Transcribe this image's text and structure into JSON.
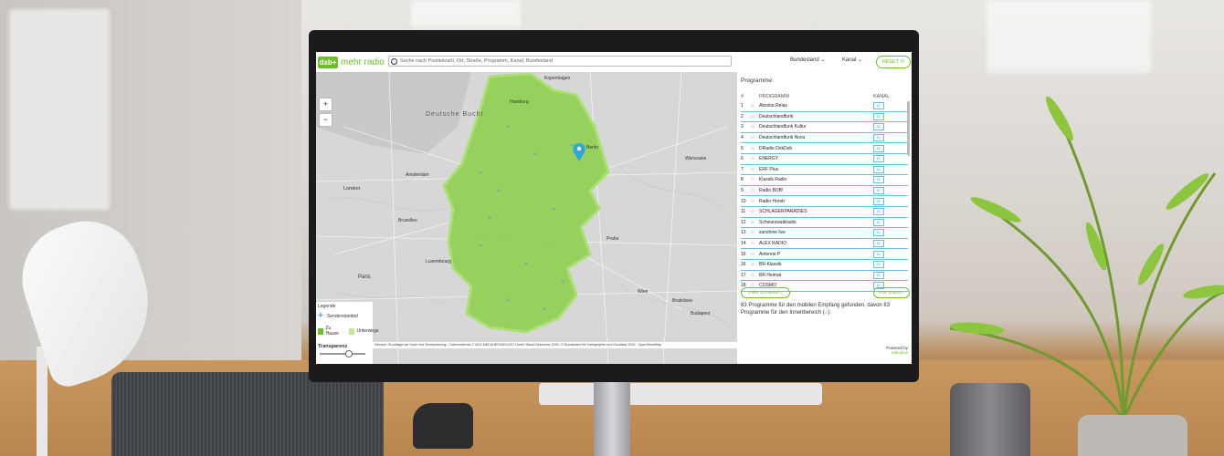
{
  "app": {
    "logo_box": "dab+",
    "logo_text": "mehr radio",
    "search_placeholder": "Suche nach Postleitzahl, Ort, Straße, Programm, Kanal, Bundesland",
    "dropdown_state": "Bundesland",
    "dropdown_channel": "Kanal",
    "reset_label": "RESET"
  },
  "map": {
    "country_label": "Deutsche Bucht",
    "cities": [
      "Hamburg",
      "Berlin",
      "Warszawa",
      "London",
      "Amsterdam",
      "Bruxelles",
      "Paris",
      "Praha",
      "Wien",
      "Budapest",
      "Luxembourg",
      "Bratislava",
      "Kopenhagen"
    ],
    "legend_title": "Legende",
    "legend_item1": "Senderstandort",
    "legend_item2a": "Zu Hause",
    "legend_item2b": "Unterwegs",
    "transparency_label": "Transparenz",
    "attribution": "Hinweis: Grundlage der Karte und Sendeplanung... Datenmaterial: © AKG MEDIA BROADCAST GmbH Stand Dezember 2020 / © Bundesamt für Kartographie und Geodäsie 2016 · OpenStreetMap"
  },
  "panel": {
    "title": "Programme:",
    "col_num": "#",
    "col_program": "PROGRAMM",
    "col_channel": "KANAL",
    "rows": [
      {
        "n": "1",
        "name": "Absolut Relax"
      },
      {
        "n": "2",
        "name": "Deutschlandfunk"
      },
      {
        "n": "3",
        "name": "Deutschlandfunk Kultur"
      },
      {
        "n": "4",
        "name": "Deutschlandfunk Nova"
      },
      {
        "n": "5",
        "name": "DRadio DokDeb"
      },
      {
        "n": "6",
        "name": "ENERGY"
      },
      {
        "n": "7",
        "name": "ERF Plus"
      },
      {
        "n": "8",
        "name": "Klassik Radio"
      },
      {
        "n": "9",
        "name": "Radio BOB!"
      },
      {
        "n": "10",
        "name": "Radio Horeb"
      },
      {
        "n": "11",
        "name": "SCHLAGERPARADIES"
      },
      {
        "n": "12",
        "name": "Schwarzwaldradio"
      },
      {
        "n": "13",
        "name": "sunshine live"
      },
      {
        "n": "14",
        "name": "ALEX RADIO"
      },
      {
        "n": "15",
        "name": "Antenne P"
      },
      {
        "n": "16",
        "name": "BR-Klassik"
      },
      {
        "n": "17",
        "name": "BR Heimat"
      },
      {
        "n": "18",
        "name": "COSMO"
      }
    ],
    "channel_tag": "5C",
    "btn_left": "Filter zu Hause",
    "btn_right": "PDF Export",
    "info_text": "83 Programme für den mobilen Empfang gefunden, davon 83 Programme für den Innenbereich (",
    "info_end": ").",
    "powered_label": "Powered by",
    "powered_sub": "radioplus"
  }
}
